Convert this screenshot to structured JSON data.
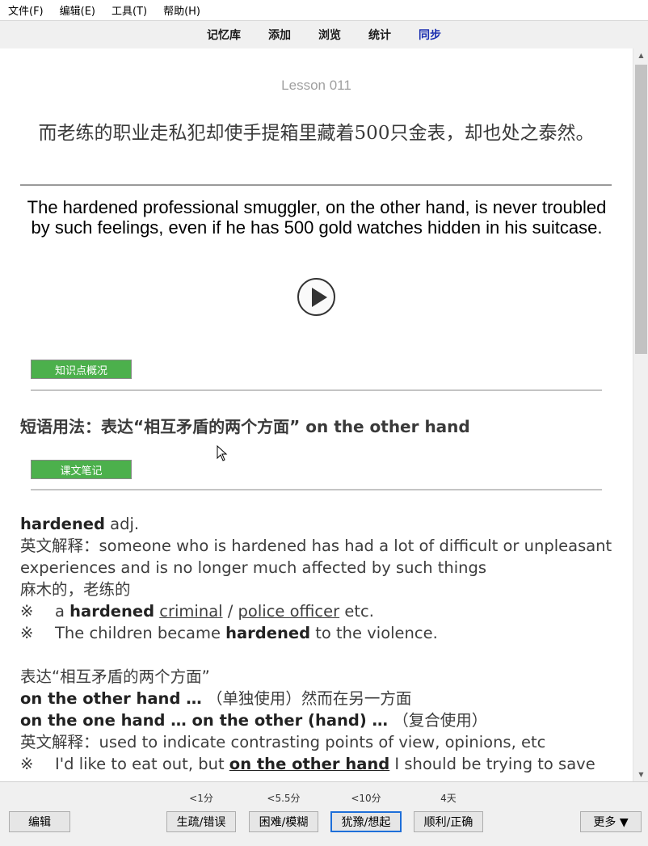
{
  "menu": {
    "file": "文件(F)",
    "edit": "编辑(E)",
    "tools": "工具(T)",
    "help": "帮助(H)"
  },
  "nav": {
    "tabs": [
      "记忆库",
      "添加",
      "浏览",
      "统计",
      "同步"
    ],
    "active": "同步"
  },
  "card": {
    "lesson_title": "Lesson 011",
    "chinese_sentence": "而老练的职业走私犯却使手提箱里藏着500只金表，却也处之泰然。",
    "english_sentence": "The hardened professional smuggler, on the other hand, is never troubled by such feelings, even if he has 500 gold watches hidden in his suitcase.",
    "knowledge_tag": "知识点概况",
    "phrase_heading": "短语用法：表达“相互矛盾的两个方面” on the other hand",
    "notes_tag": "课文笔记",
    "notes": {
      "word": "hardened",
      "pos": " adj.",
      "def_label": "英文解释：",
      "def_text": "someone who is hardened has had a lot of difficult or unpleasant experiences and is no longer much affected by such things",
      "cn_meaning": "麻木的，老练的",
      "bullet": "※",
      "ex1_a": "a ",
      "ex1_word": "hardened",
      "ex1_sp": " ",
      "ex1_u1": "criminal",
      "ex1_slash": " / ",
      "ex1_u2": "police officer",
      "ex1_end": " etc.",
      "ex2_a": "The children became ",
      "ex2_word": "hardened",
      "ex2_end": " to the violence.",
      "express_title": "表达“相互矛盾的两个方面”",
      "usage1_b": "on the other hand …",
      "usage1_t": " （单独使用）然而在另一方面",
      "usage2_b": "on the one hand … on the other (hand) …",
      "usage2_t": " （复合使用）",
      "def2_label": "英文解释：",
      "def2_text": "used to indicate contrasting points of view, opinions, etc",
      "ex3_a": "I'd like to eat out, but ",
      "ex3_u": "on the other hand",
      "ex3_end": " I should be trying to save"
    }
  },
  "footer": {
    "edit_button": "编辑",
    "intervals": [
      "<1分",
      "<5.5分",
      "<10分",
      "4天"
    ],
    "answers": [
      "生疏/错误",
      "困难/模糊",
      "犹豫/想起",
      "顺利/正确"
    ],
    "focused_answer": "犹豫/想起",
    "more_button": "更多 ▼"
  }
}
